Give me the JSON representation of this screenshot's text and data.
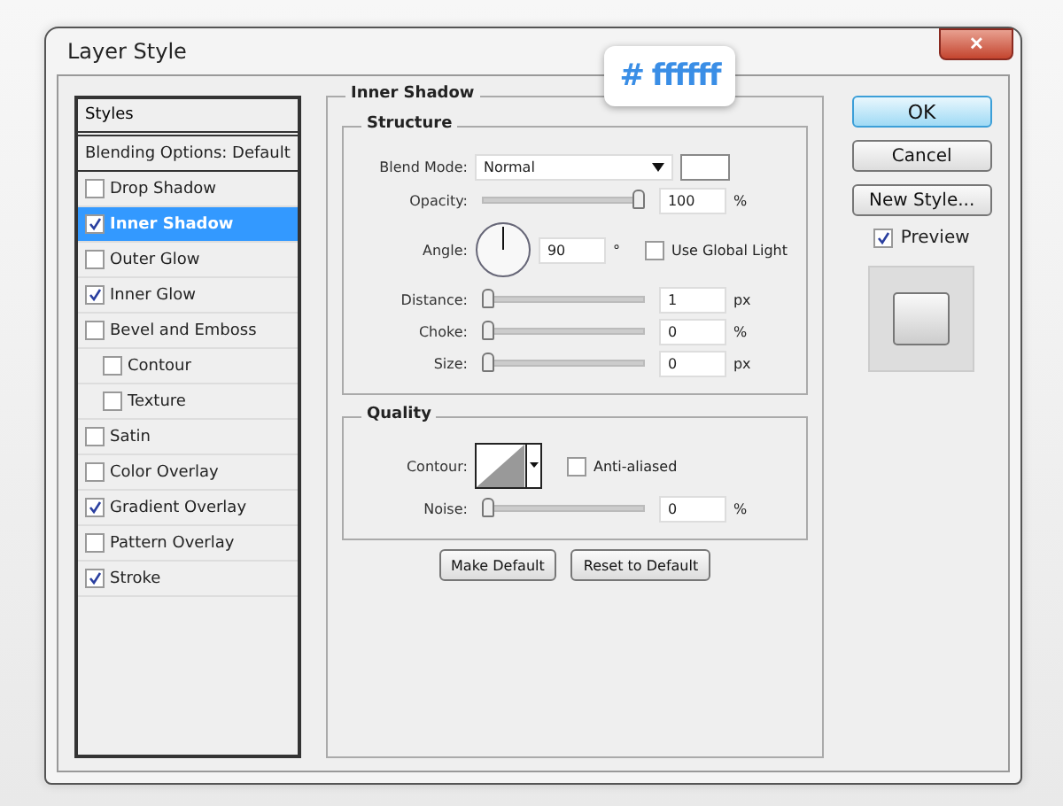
{
  "window": {
    "title": "Layer Style",
    "close": "✕"
  },
  "styles_header": "Styles",
  "styles": [
    {
      "kind": "plain",
      "label": "Blending Options: Default",
      "selected": false
    },
    {
      "kind": "check",
      "label": "Drop Shadow",
      "checked": false,
      "selected": false
    },
    {
      "kind": "check",
      "label": "Inner Shadow",
      "checked": true,
      "selected": true
    },
    {
      "kind": "check",
      "label": "Outer Glow",
      "checked": false,
      "selected": false
    },
    {
      "kind": "check",
      "label": "Inner Glow",
      "checked": true,
      "selected": false
    },
    {
      "kind": "check",
      "label": "Bevel and Emboss",
      "checked": false,
      "selected": false,
      "children": [
        {
          "kind": "check",
          "label": "Contour",
          "checked": false,
          "selected": false
        },
        {
          "kind": "check",
          "label": "Texture",
          "checked": false,
          "selected": false
        }
      ]
    },
    {
      "kind": "check",
      "label": "Satin",
      "checked": false,
      "selected": false
    },
    {
      "kind": "check",
      "label": "Color Overlay",
      "checked": false,
      "selected": false
    },
    {
      "kind": "check",
      "label": "Gradient Overlay",
      "checked": true,
      "selected": false
    },
    {
      "kind": "check",
      "label": "Pattern Overlay",
      "checked": false,
      "selected": false
    },
    {
      "kind": "check",
      "label": "Stroke",
      "checked": true,
      "selected": false
    }
  ],
  "panel_title": "Inner Shadow",
  "structure": {
    "title": "Structure",
    "blend_mode": {
      "label": "Blend Mode:",
      "value": "Normal"
    },
    "opacity": {
      "label": "Opacity:",
      "level": 1,
      "value": "100",
      "unit": "%"
    },
    "angle": {
      "label": "Angle:",
      "value": "90",
      "unit": "°",
      "global_light": {
        "label": "Use Global Light",
        "checked": false
      }
    },
    "sliders": [
      {
        "label": "Distance:",
        "level": 0,
        "value": "1",
        "unit": "px"
      },
      {
        "label": "Choke:",
        "level": 0,
        "value": "0",
        "unit": "%"
      },
      {
        "label": "Size:",
        "level": 0,
        "value": "0",
        "unit": "px"
      }
    ]
  },
  "quality": {
    "title": "Quality",
    "contour_label": "Contour:",
    "anti_aliased": {
      "label": "Anti-aliased",
      "checked": false
    },
    "noise": {
      "label": "Noise:",
      "level": 0,
      "value": "0",
      "unit": "%"
    }
  },
  "defaults_buttons": [
    "Make Default",
    "Reset to Default"
  ],
  "side_buttons": [
    {
      "label": "OK",
      "primary": true
    },
    {
      "label": "Cancel",
      "primary": false
    },
    {
      "label": "New Style...",
      "primary": false
    }
  ],
  "preview": {
    "label": "Preview",
    "checked": true
  },
  "annotation": "# ffffff"
}
